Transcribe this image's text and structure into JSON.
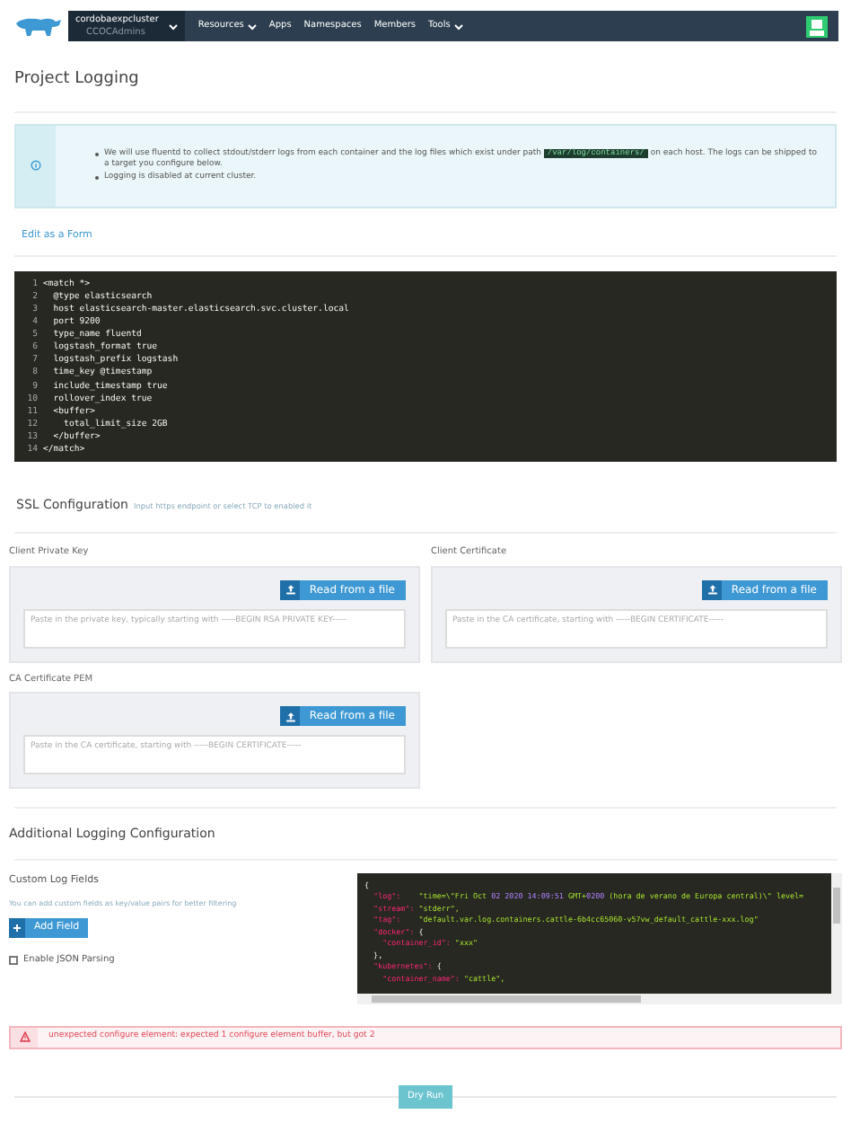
{
  "nav": {
    "cluster": "cordobaexpcluster",
    "project": "CCOCAdmins",
    "items": [
      {
        "label": "Resources",
        "dropdown": true
      },
      {
        "label": "Apps",
        "dropdown": false
      },
      {
        "label": "Namespaces",
        "dropdown": false
      },
      {
        "label": "Members",
        "dropdown": false
      },
      {
        "label": "Tools",
        "dropdown": true
      }
    ]
  },
  "title": "Project Logging",
  "info": {
    "items": [
      {
        "before": "We will use fluentd to collect stdout/stderr logs from each container and the log files which exist under path ",
        "code": "/var/log/containers/",
        "after": " on each host. The logs can be shipped to a target you configure below."
      },
      {
        "before": "Logging is disabled at current cluster."
      }
    ]
  },
  "edit_link": "Edit as a Form",
  "code": [
    {
      "n": "1",
      "text": "<match *>"
    },
    {
      "n": "2",
      "text": "  @type elasticsearch"
    },
    {
      "n": "3",
      "text": "  host elasticsearch-master.elasticsearch.svc.cluster.local"
    },
    {
      "n": "4",
      "text": "  port 9200"
    },
    {
      "n": "5",
      "text": "  type_name fluentd"
    },
    {
      "n": "6",
      "text": "  logstash_format true"
    },
    {
      "n": "7",
      "text": "  logstash_prefix logstash"
    },
    {
      "n": "8",
      "text": "  time_key @timestamp"
    },
    {
      "n": "9",
      "text": "  include_timestamp true"
    },
    {
      "n": "10",
      "text": "  rollover_index true"
    },
    {
      "n": "11",
      "text": "  <buffer>"
    },
    {
      "n": "12",
      "text": "    total_limit_size 2GB"
    },
    {
      "n": "13",
      "text": "  </buffer>"
    },
    {
      "n": "14",
      "text": "</match>"
    }
  ],
  "ssl": {
    "title": "SSL Configuration",
    "hint": "Input https endpoint or select TCP to enabled it",
    "fields": [
      {
        "label": "Client Private Key",
        "button": "Read from a file",
        "placeholder": "Paste in the private key, typically starting with -----BEGIN RSA PRIVATE KEY-----"
      },
      {
        "label": "Client Certificate",
        "button": "Read from a file",
        "placeholder": "Paste in the CA certificate, starting with -----BEGIN CERTIFICATE-----"
      },
      {
        "label": "CA Certificate PEM",
        "button": "Read from a file",
        "placeholder": "Paste in the CA certificate, starting with -----BEGIN CERTIFICATE-----"
      }
    ]
  },
  "additional": {
    "title": "Additional Logging Configuration",
    "custom_label": "Custom Log Fields",
    "custom_hint": "You can add custom fields as key/value pairs for better filtering",
    "add_button": "Add Field",
    "json_parsing": {
      "label": "Enable JSON Parsing",
      "checked": false
    },
    "sample": [
      [
        {
          "kind": "punct",
          "text": "{"
        }
      ],
      [
        {
          "kind": "key",
          "text": "  \"log\":"
        },
        {
          "kind": "string",
          "text": "    \"time=\\\"Fri Oct "
        },
        {
          "kind": "number",
          "text": "02 2020 14:09:51"
        },
        {
          "kind": "string",
          "text": " GMT+"
        },
        {
          "kind": "number",
          "text": "0200"
        },
        {
          "kind": "string",
          "text": " (hora de verano de Europa central)\\\" level="
        }
      ],
      [
        {
          "kind": "key",
          "text": "  \"stream\":"
        },
        {
          "kind": "string",
          "text": " \"stderr\","
        }
      ],
      [
        {
          "kind": "key",
          "text": "  \"tag\":"
        },
        {
          "kind": "string",
          "text": "    \"default.var.log.containers.cattle-6b4cc65060-v57vw_default_cattle-xxx.log\""
        }
      ],
      [
        {
          "kind": "key",
          "text": "  \"docker\":"
        },
        {
          "kind": "punct",
          "text": " {"
        }
      ],
      [
        {
          "kind": "key",
          "text": "    \"container_id\":"
        },
        {
          "kind": "string",
          "text": " \"xxx\""
        }
      ],
      [
        {
          "kind": "punct",
          "text": "  },"
        }
      ],
      [
        {
          "kind": "key",
          "text": "  \"kubernetes\":"
        },
        {
          "kind": "punct",
          "text": " {"
        }
      ],
      [
        {
          "kind": "key",
          "text": "    \"container_name\":"
        },
        {
          "kind": "string",
          "text": " \"cattle\","
        }
      ]
    ]
  },
  "error": "unexpected configure element: expected 1 configure element buffer, but got 2",
  "dry_run": "Dry Run"
}
